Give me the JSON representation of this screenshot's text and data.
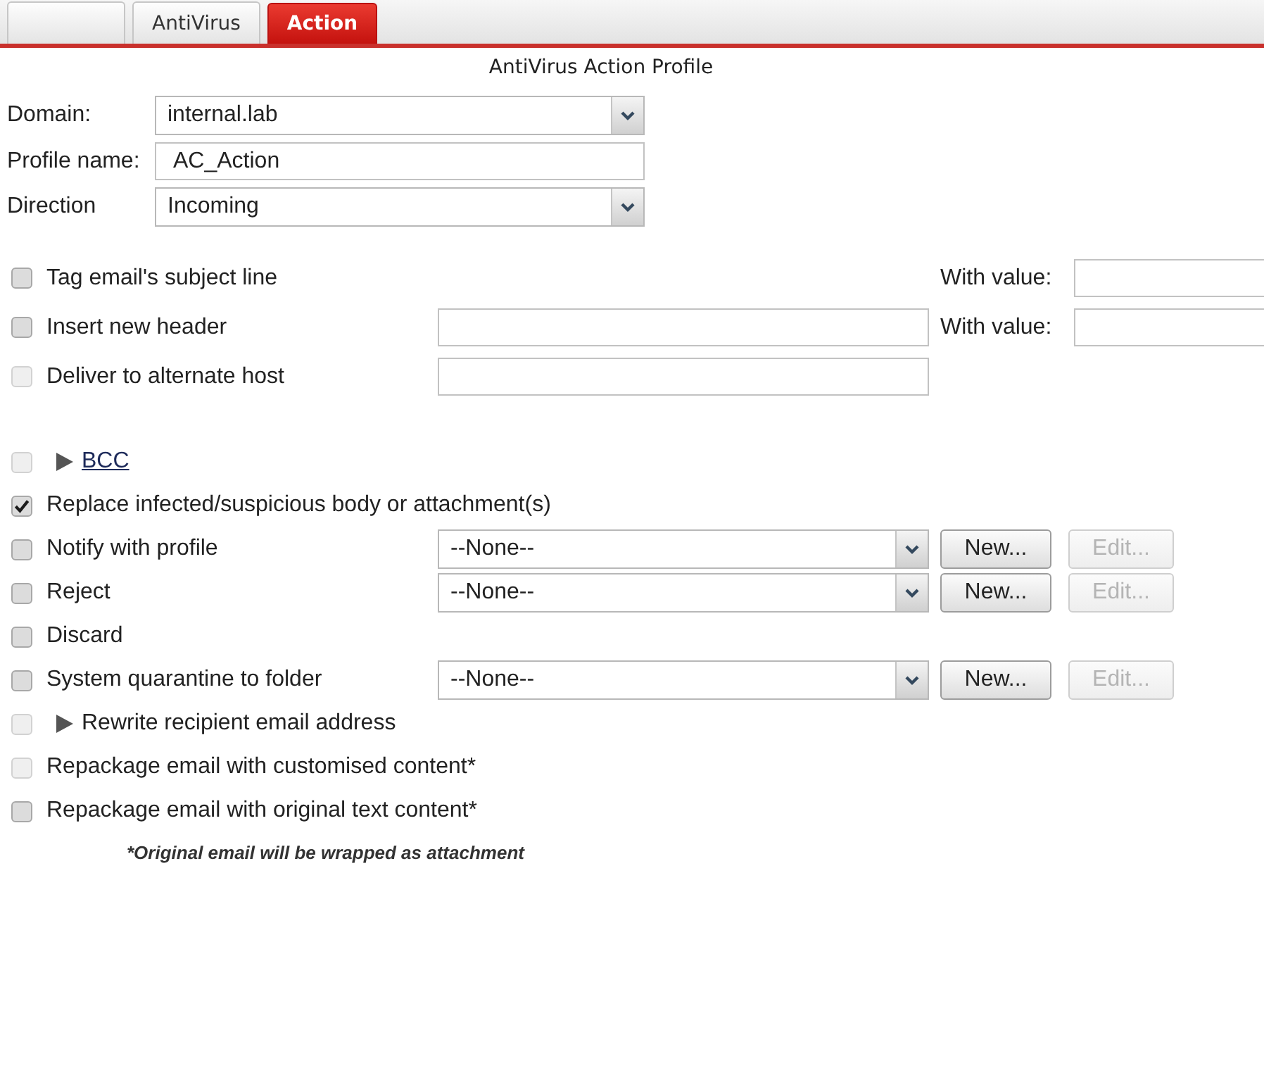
{
  "tabs": [
    {
      "selected": false
    },
    {
      "label": "AntiVirus",
      "selected": false
    },
    {
      "label": "Action",
      "selected": true
    }
  ],
  "title": "AntiVirus Action Profile",
  "fields": [
    {
      "kind": "select",
      "label": "Domain:",
      "value": "internal.lab"
    },
    {
      "kind": "text",
      "label": "Profile name:",
      "value": "AC_Action"
    },
    {
      "kind": "select",
      "label": "Direction",
      "value": "Incoming"
    }
  ],
  "sections": [
    {
      "options": [
        {
          "kind": "check",
          "label": "Tag email's subject line",
          "checked": false,
          "disabled": false,
          "with_value": "With value:"
        },
        {
          "kind": "check",
          "label": "Insert new header",
          "checked": false,
          "disabled": false,
          "text_field": true,
          "with_value": "With value:"
        },
        {
          "kind": "check",
          "label": "Deliver to alternate host",
          "checked": false,
          "disabled": true,
          "text_field": true
        }
      ]
    },
    {
      "options": [
        {
          "kind": "expander_link",
          "label": "BCC",
          "checked": false,
          "disabled": true
        },
        {
          "kind": "check",
          "label": "Replace infected/suspicious body or attachment(s)",
          "checked": true,
          "disabled": false
        },
        {
          "kind": "check",
          "label": "Notify with profile",
          "checked": false,
          "disabled": false,
          "select": "--None--",
          "buttons": [
            {
              "label": "New...",
              "disabled": false
            },
            {
              "label": "Edit...",
              "disabled": true
            }
          ]
        },
        {
          "kind": "check",
          "label": "Reject",
          "checked": false,
          "disabled": false,
          "select": "--None--",
          "buttons": [
            {
              "label": "New...",
              "disabled": false
            },
            {
              "label": "Edit...",
              "disabled": true
            }
          ]
        },
        {
          "kind": "check",
          "label": "Discard",
          "checked": false,
          "disabled": false
        },
        {
          "kind": "check",
          "label": "System quarantine to folder",
          "checked": false,
          "disabled": false,
          "select": "--None--",
          "buttons": [
            {
              "label": "New...",
              "disabled": false
            },
            {
              "label": "Edit...",
              "disabled": true
            }
          ]
        },
        {
          "kind": "expander",
          "label": "Rewrite recipient email address",
          "checked": false,
          "disabled": true
        },
        {
          "kind": "check",
          "label": "Repackage email with customised content*",
          "checked": false,
          "disabled": true
        },
        {
          "kind": "check",
          "label": "Repackage email with original text content*",
          "checked": false,
          "disabled": false
        }
      ]
    }
  ],
  "note": "*Original email will be wrapped as attachment"
}
